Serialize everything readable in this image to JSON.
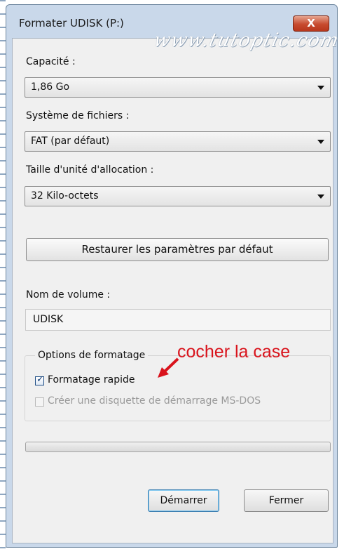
{
  "window": {
    "title": "Formater UDISK (P:)",
    "watermark": "www.tutoptic.com",
    "close_label": "X"
  },
  "capacity": {
    "label": "Capacité :",
    "value": "1,86 Go"
  },
  "filesystem": {
    "label": "Système de fichiers :",
    "value": "FAT (par défaut)"
  },
  "allocation": {
    "label": "Taille d'unité d'allocation :",
    "value": "32 Kilo-octets"
  },
  "restore_button": "Restaurer les paramètres par défaut",
  "volume": {
    "label": "Nom de volume :",
    "value": "UDISK"
  },
  "format_options": {
    "title": "Options de formatage",
    "quick_format": {
      "label": "Formatage rapide",
      "checked": true
    },
    "msdos_disk": {
      "label": "Créer une disquette de démarrage MS-DOS",
      "checked": false,
      "enabled": false
    }
  },
  "annotation": "cocher la case",
  "progress": {
    "value": 0
  },
  "buttons": {
    "start": "Démarrer",
    "close": "Fermer"
  },
  "icons": {
    "close": "close-icon",
    "dropdown": "chevron-down-icon",
    "check": "check-icon"
  },
  "colors": {
    "annotation": "#d9131c",
    "title_bar": "#c9d8ea",
    "close_button": "#c74b2f"
  }
}
